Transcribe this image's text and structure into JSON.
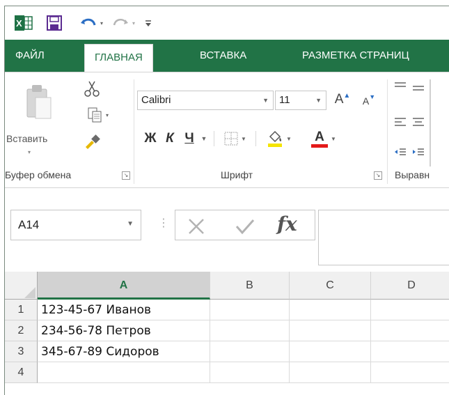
{
  "quick_access": {
    "icons": [
      "excel-logo-icon",
      "save-icon",
      "undo-icon",
      "redo-icon",
      "customize-icon"
    ]
  },
  "tabs": [
    {
      "label": "ФАЙЛ"
    },
    {
      "label": "ГЛАВНАЯ"
    },
    {
      "label": "ВСТАВКА"
    },
    {
      "label": "РАЗМЕТКА СТРАНИЦ"
    }
  ],
  "ribbon": {
    "clipboard": {
      "paste_label": "Вставить",
      "group_label": "Буфер обмена"
    },
    "font": {
      "font_name": "Calibri",
      "font_size": "11",
      "bold": "Ж",
      "italic": "К",
      "underline": "Ч",
      "font_color_letter": "A",
      "grow_letter": "A",
      "shrink_letter": "A",
      "group_label": "Шрифт"
    },
    "alignment": {
      "group_label": "Выравн"
    }
  },
  "formula_bar": {
    "name_box": "A14",
    "fx_label": "fx",
    "formula": ""
  },
  "grid": {
    "columns": [
      "A",
      "B",
      "C",
      "D"
    ],
    "rows": [
      {
        "num": "1",
        "a": "123-45-67 Иванов"
      },
      {
        "num": "2",
        "a": "234-56-78 Петров"
      },
      {
        "num": "3",
        "a": "345-67-89 Сидоров"
      },
      {
        "num": "4",
        "a": ""
      }
    ]
  },
  "colors": {
    "excel_green": "#217346",
    "font_color_bar": "#e41a1a"
  }
}
